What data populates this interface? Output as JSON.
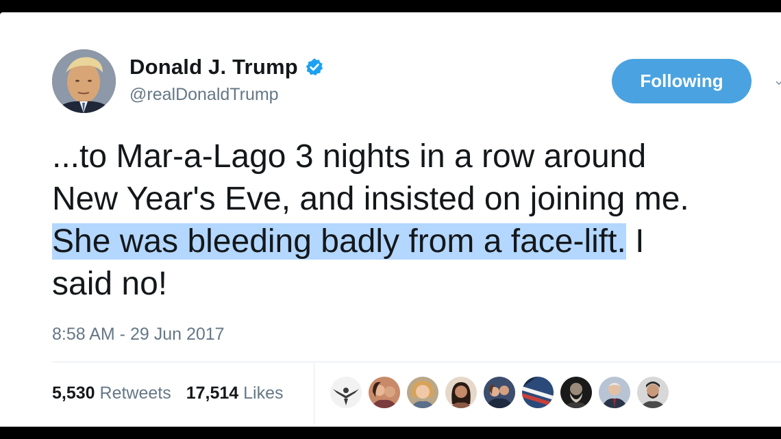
{
  "profile": {
    "name": "Donald J. Trump",
    "handle": "@realDonaldTrump",
    "avatar_icon": "profile-photo",
    "verified_icon": "verified-badge-icon"
  },
  "follow_button": {
    "label": "Following"
  },
  "tweet": {
    "line1": "...to Mar-a-Lago 3 nights in a row around",
    "line2": "New Year's Eve, and insisted on joining me.",
    "line3_highlighted": "She was bleeding badly from a face-lift.",
    "line3_rest": " I",
    "line4": "said no!"
  },
  "timestamp": "8:58 AM - 29 Jun 2017",
  "stats": {
    "retweets_count": "5,530",
    "retweets_label": "Retweets",
    "likes_count": "17,514",
    "likes_label": "Likes"
  },
  "likers": [
    {
      "icon": "eagle-avatar-icon",
      "color": "#f2f2f2"
    },
    {
      "icon": "couple-avatar-icon",
      "color": "#c98a6a"
    },
    {
      "icon": "woman-avatar-icon",
      "color": "#d7a35a"
    },
    {
      "icon": "woman-avatar-icon",
      "color": "#8a5a45"
    },
    {
      "icon": "couple-avatar-icon",
      "color": "#3c4d6e"
    },
    {
      "icon": "flag-avatar-icon",
      "color": "#2b4a7a"
    },
    {
      "icon": "man-avatar-icon",
      "color": "#1a1a1a"
    },
    {
      "icon": "man-avatar-icon",
      "color": "#6b7d95"
    },
    {
      "icon": "man-avatar-icon",
      "color": "#4a4a4a"
    }
  ],
  "colors": {
    "accent": "#4aa3e0",
    "highlight": "#b3d7ff",
    "secondary_text": "#657786",
    "primary_text": "#14171a"
  }
}
